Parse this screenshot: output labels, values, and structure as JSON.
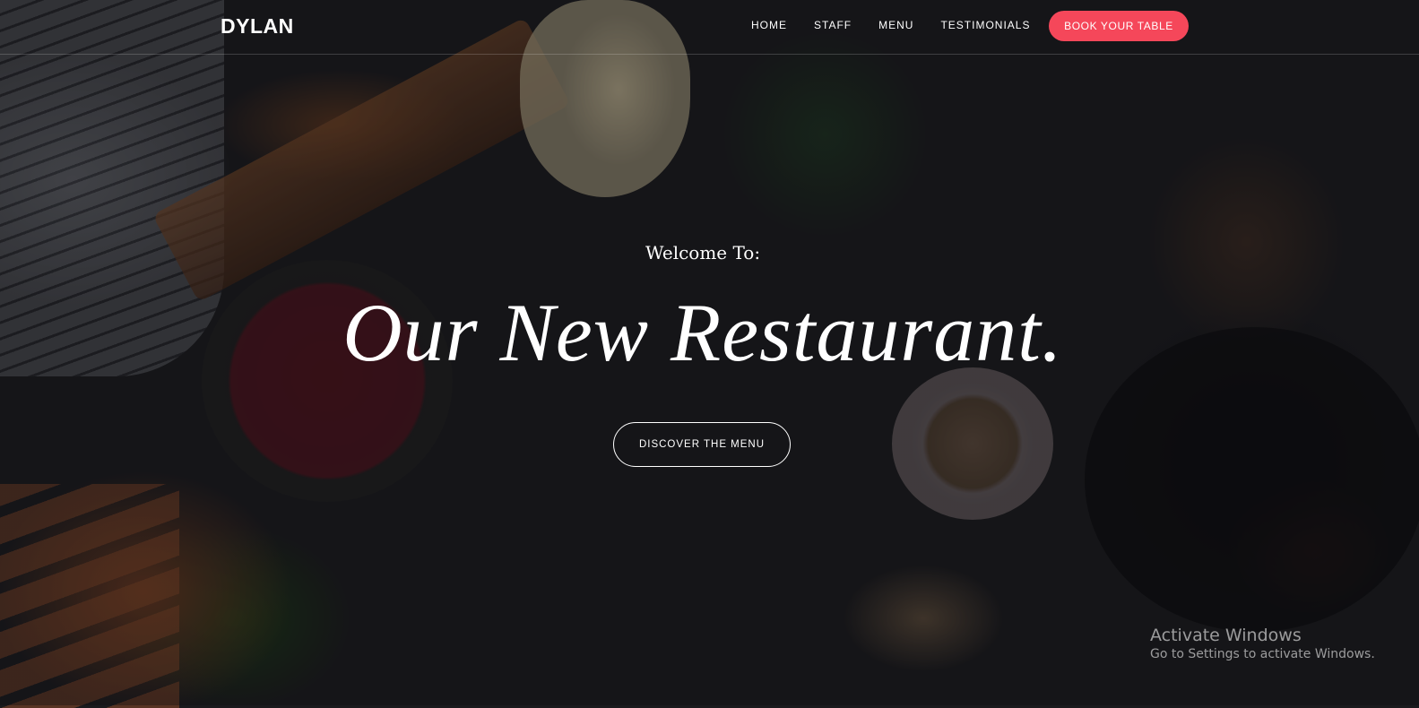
{
  "nav": {
    "logo": "DYLAN",
    "items": [
      {
        "label": "HOME"
      },
      {
        "label": "STAFF"
      },
      {
        "label": "MENU"
      },
      {
        "label": "TESTIMONIALS"
      }
    ],
    "cta_label": "BOOK YOUR TABLE",
    "accent_color": "#f5475a"
  },
  "hero": {
    "welcome": "Welcome To:",
    "title": "Our New Restaurant.",
    "button_label": "DISCOVER THE MENU"
  },
  "watermark": {
    "title": "Activate Windows",
    "subtitle": "Go to Settings to activate Windows."
  }
}
